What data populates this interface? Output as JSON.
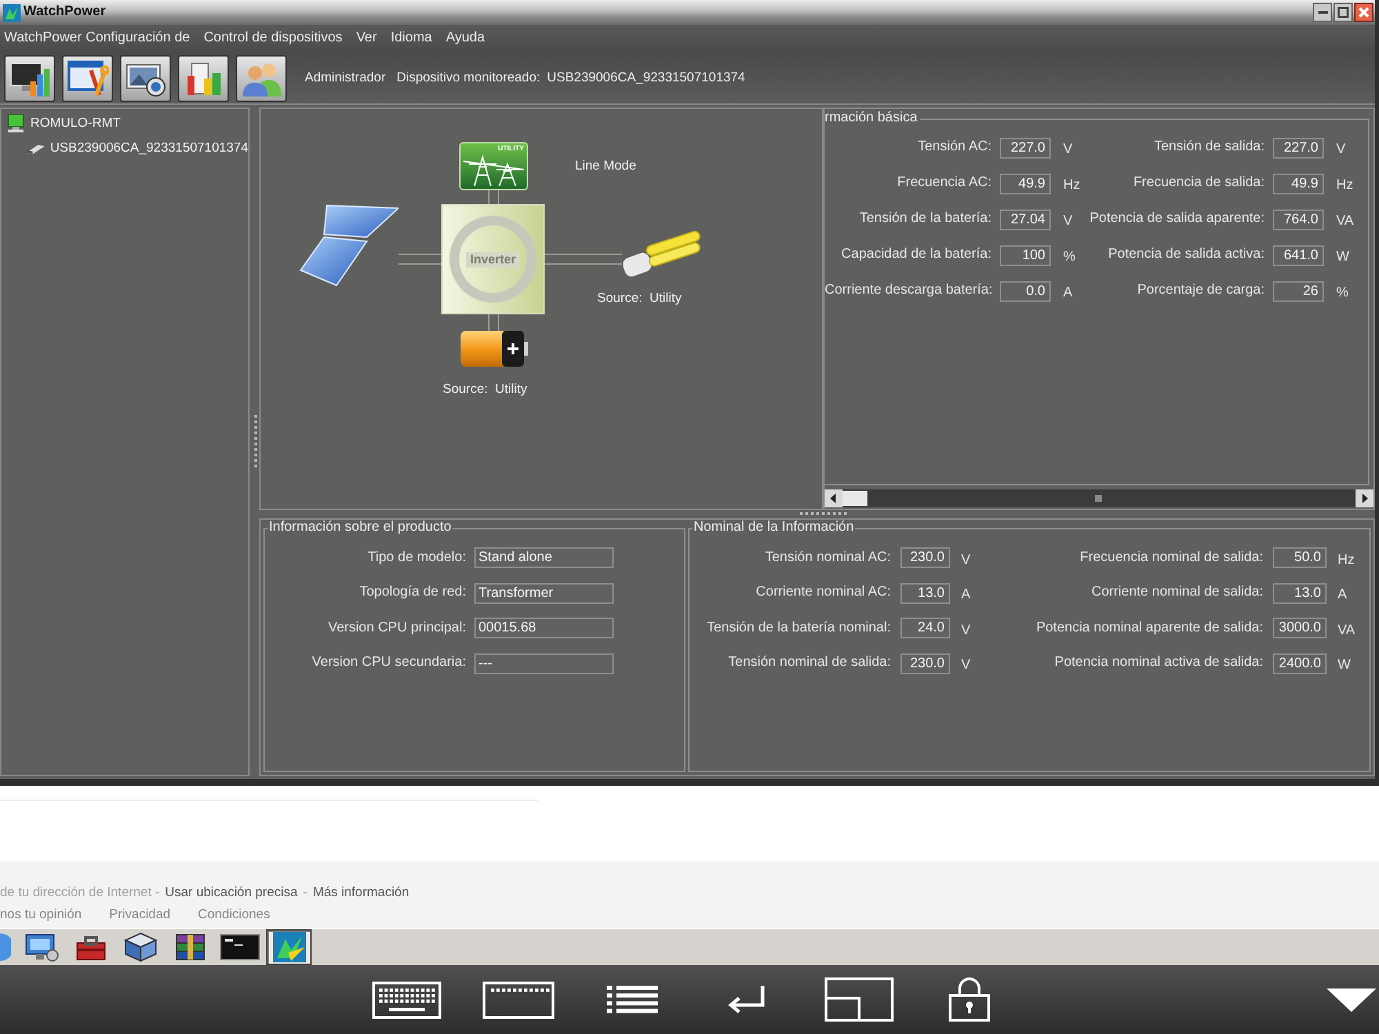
{
  "window": {
    "title": "WatchPower"
  },
  "menu": [
    "WatchPower Configuración de",
    "Control de dispositivos",
    "Ver",
    "Idioma",
    "Ayuda"
  ],
  "toolbar": {
    "user": "Administrador",
    "device_label": "Dispositivo monitoreado:",
    "device_id": "USB239006CA_92331507101374"
  },
  "tree": [
    {
      "label": "ROMULO-RMT",
      "children": [
        {
          "label": "USB239006CA_92331507101374"
        }
      ]
    }
  ],
  "diagram": {
    "utility_label": "UTILITY",
    "mode": "Line Mode",
    "inverter_label": "Inverter",
    "load_source": "Source:  Utility",
    "battery_source": "Source:  Utility"
  },
  "basic_info": {
    "title": "rmación básica",
    "fields": [
      {
        "label": "Tensión AC:",
        "value": "227.0",
        "unit": "V"
      },
      {
        "label": "Tensión de salida:",
        "value": "227.0",
        "unit": "V"
      },
      {
        "label": "Frecuencia AC:",
        "value": "49.9",
        "unit": "Hz"
      },
      {
        "label": "Frecuencia de salida:",
        "value": "49.9",
        "unit": "Hz"
      },
      {
        "label": "Tensión de la batería:",
        "value": "27.04",
        "unit": "V"
      },
      {
        "label": "Potencia de salida aparente:",
        "value": "764.0",
        "unit": "VA"
      },
      {
        "label": "Capacidad de la batería:",
        "value": "100",
        "unit": "%"
      },
      {
        "label": "Potencia de salida activa:",
        "value": "641.0",
        "unit": "W"
      },
      {
        "label": "Corriente descarga batería:",
        "value": "0.0",
        "unit": "A"
      },
      {
        "label": "Porcentaje de carga:",
        "value": "26",
        "unit": "%"
      }
    ]
  },
  "product_info": {
    "title": "Información sobre el producto",
    "fields": [
      {
        "label": "Tipo de modelo:",
        "value": "Stand alone"
      },
      {
        "label": "Topología de red:",
        "value": "Transformer"
      },
      {
        "label": "Version CPU principal:",
        "value": "00015.68"
      },
      {
        "label": "Version CPU secundaria:",
        "value": "---"
      }
    ]
  },
  "nominal_info": {
    "title": "Nominal de la Información",
    "fields": [
      {
        "label": "Tensión nominal AC:",
        "value": "230.0",
        "unit": "V"
      },
      {
        "label": "Frecuencia nominal de salida:",
        "value": "50.0",
        "unit": "Hz"
      },
      {
        "label": "Corriente nominal AC:",
        "value": "13.0",
        "unit": "A"
      },
      {
        "label": "Corriente nominal de salida:",
        "value": "13.0",
        "unit": "A"
      },
      {
        "label": "Tensión de la batería nominal:",
        "value": "24.0",
        "unit": "V"
      },
      {
        "label": "Potencia nominal aparente de salida:",
        "value": "3000.0",
        "unit": "VA"
      },
      {
        "label": "Tensión nominal de salida:",
        "value": "230.0",
        "unit": "V"
      },
      {
        "label": "Potencia nominal activa de salida:",
        "value": "2400.0",
        "unit": "W"
      }
    ]
  },
  "browser": {
    "location_line": [
      {
        "kind": "text",
        "text": "de tu dirección de Internet -"
      },
      {
        "kind": "link",
        "text": "Usar ubicación precisa"
      },
      {
        "kind": "text",
        "text": "-"
      },
      {
        "kind": "link",
        "text": "Más información"
      }
    ],
    "footer_links": [
      "nos tu opinión",
      "Privacidad",
      "Condiciones"
    ]
  },
  "taskbar": [
    {
      "selected": false
    },
    {
      "selected": false
    },
    {
      "selected": false
    },
    {
      "selected": false
    },
    {
      "selected": false
    },
    {
      "selected": false
    },
    {
      "selected": true
    }
  ]
}
